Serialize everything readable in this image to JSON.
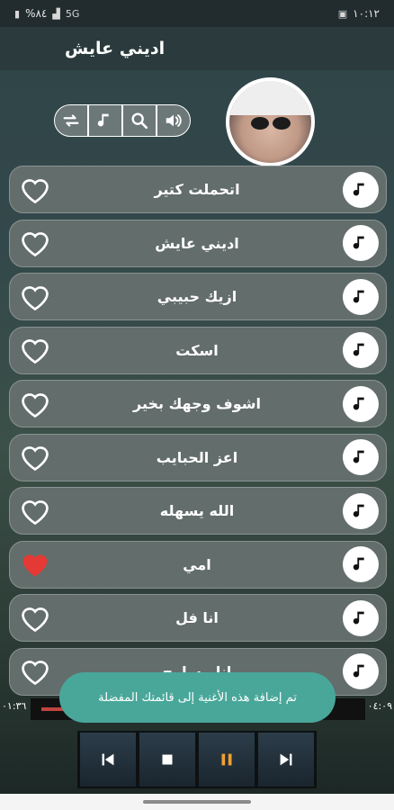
{
  "status_bar": {
    "time": "١٠:١٢",
    "battery": "%٨٤",
    "network": "5G"
  },
  "app_bar": {
    "title": "اديني عايش"
  },
  "controls": [
    "repeat-icon",
    "music-note-icon",
    "search-icon",
    "volume-icon"
  ],
  "songs": [
    {
      "title": "اتحملت كتير",
      "favorite": false
    },
    {
      "title": "اديني عايش",
      "favorite": false
    },
    {
      "title": "ازيك حبيبي",
      "favorite": false
    },
    {
      "title": "اسكت",
      "favorite": false
    },
    {
      "title": "اشوف وجهك بخير",
      "favorite": false
    },
    {
      "title": "اعز الحبايب",
      "favorite": false
    },
    {
      "title": "الله يسهله",
      "favorite": false
    },
    {
      "title": "امي",
      "favorite": true
    },
    {
      "title": "انا فل",
      "favorite": false
    },
    {
      "title": "انا مسامح",
      "favorite": false
    }
  ],
  "player": {
    "elapsed": "٠١:٣٦",
    "duration": "٠٤:٠٩",
    "progress": 0.385,
    "buttons": [
      "previous-icon",
      "stop-icon",
      "pause-icon",
      "next-icon"
    ]
  },
  "toast": {
    "message": "تم إضافة هذه الأغنية إلى قائمتك المفضلة"
  },
  "colors": {
    "accent": "#49a79a",
    "heart_active": "#e53935",
    "seek_fill": "#c0453f"
  }
}
